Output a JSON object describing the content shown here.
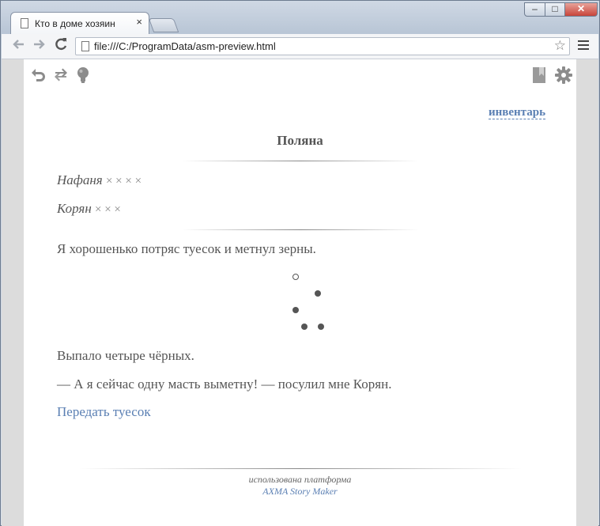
{
  "browser": {
    "tab_title": "Кто в доме хозяин",
    "tab_close": "×",
    "url": "file:///C:/ProgramData/asm-preview.html",
    "nav_back": "⮜",
    "nav_forward": "⮞",
    "nav_reload": "C",
    "star": "☆",
    "win_min": "–",
    "win_max": "□",
    "win_close": "✕"
  },
  "story": {
    "toolbar_icons": [
      "undo-icon",
      "restart-icon",
      "hint-icon",
      "bookmark-icon",
      "settings-icon"
    ],
    "inventory_label": "инвентарь",
    "location_title": "Поляна",
    "stats": [
      {
        "name": "Нафаня",
        "marks": "× × × ×"
      },
      {
        "name": "Корян",
        "marks": "× × ×"
      }
    ],
    "paragraph_1": "Я хорошенько потряс туесок и метнул зерны.",
    "stones": [
      {
        "color": "white"
      },
      {
        "color": "black"
      },
      {
        "color": "black"
      },
      {
        "color": "black"
      },
      {
        "color": "black"
      }
    ],
    "paragraph_2": "Выпало четыре чёрных.",
    "paragraph_3": "— А я сейчас одну масть выметну! — посулил мне Корян.",
    "action_label": "Передать туесок",
    "footer_text": "использована платформа",
    "footer_link": "AXMA Story Maker"
  },
  "colors": {
    "link": "#5a7fb3",
    "text": "#555555",
    "page_bg": "#ffffff",
    "margin_bg": "#dcdcdc"
  }
}
